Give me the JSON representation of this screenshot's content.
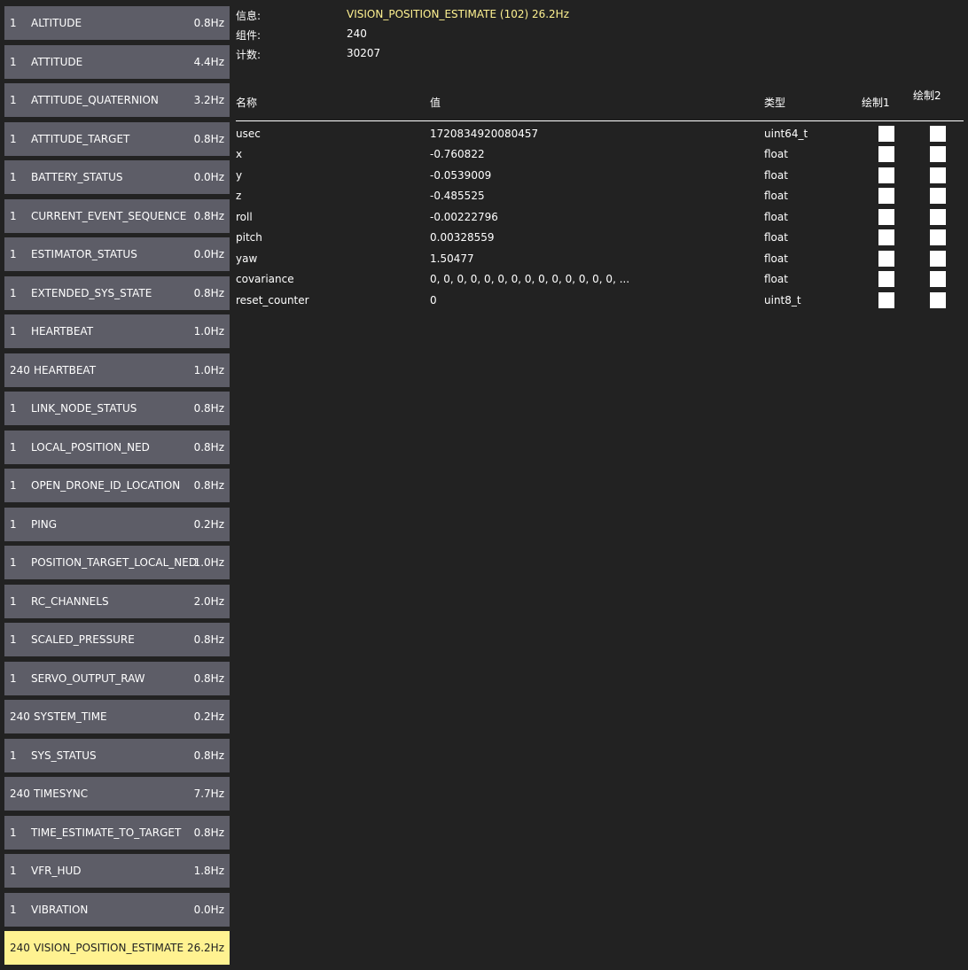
{
  "info": {
    "message_label": "信息:",
    "message_value": "VISION_POSITION_ESTIMATE (102) 26.2Hz",
    "component_label": "组件:",
    "component_value": "240",
    "count_label": "计数:",
    "count_value": "30207"
  },
  "table": {
    "headers": {
      "name": "名称",
      "value": "值",
      "type": "类型",
      "plot1": "绘制1",
      "plot2": "绘制2"
    },
    "rows": [
      {
        "name": "usec",
        "value": "1720834920080457",
        "type": "uint64_t"
      },
      {
        "name": "x",
        "value": "-0.760822",
        "type": "float"
      },
      {
        "name": "y",
        "value": "-0.0539009",
        "type": "float"
      },
      {
        "name": "z",
        "value": "-0.485525",
        "type": "float"
      },
      {
        "name": "roll",
        "value": "-0.00222796",
        "type": "float"
      },
      {
        "name": "pitch",
        "value": "0.00328559",
        "type": "float"
      },
      {
        "name": "yaw",
        "value": "1.50477",
        "type": "float"
      },
      {
        "name": "covariance",
        "value": "0, 0, 0, 0, 0, 0, 0, 0, 0, 0, 0, 0, 0, 0, ...",
        "type": "float"
      },
      {
        "name": "reset_counter",
        "value": "0",
        "type": "uint8_t"
      }
    ]
  },
  "messages": [
    {
      "comp": "1",
      "name": "ALTITUDE",
      "rate": "0.8Hz"
    },
    {
      "comp": "1",
      "name": "ATTITUDE",
      "rate": "4.4Hz"
    },
    {
      "comp": "1",
      "name": "ATTITUDE_QUATERNION",
      "rate": "3.2Hz"
    },
    {
      "comp": "1",
      "name": "ATTITUDE_TARGET",
      "rate": "0.8Hz"
    },
    {
      "comp": "1",
      "name": "BATTERY_STATUS",
      "rate": "0.0Hz"
    },
    {
      "comp": "1",
      "name": "CURRENT_EVENT_SEQUENCE",
      "rate": "0.8Hz"
    },
    {
      "comp": "1",
      "name": "ESTIMATOR_STATUS",
      "rate": "0.0Hz"
    },
    {
      "comp": "1",
      "name": "EXTENDED_SYS_STATE",
      "rate": "0.8Hz"
    },
    {
      "comp": "1",
      "name": "HEARTBEAT",
      "rate": "1.0Hz"
    },
    {
      "comp": "240",
      "name": "HEARTBEAT",
      "rate": "1.0Hz"
    },
    {
      "comp": "1",
      "name": "LINK_NODE_STATUS",
      "rate": "0.8Hz"
    },
    {
      "comp": "1",
      "name": "LOCAL_POSITION_NED",
      "rate": "0.8Hz"
    },
    {
      "comp": "1",
      "name": "OPEN_DRONE_ID_LOCATION",
      "rate": "0.8Hz"
    },
    {
      "comp": "1",
      "name": "PING",
      "rate": "0.2Hz"
    },
    {
      "comp": "1",
      "name": "POSITION_TARGET_LOCAL_NED",
      "rate": "1.0Hz"
    },
    {
      "comp": "1",
      "name": "RC_CHANNELS",
      "rate": "2.0Hz"
    },
    {
      "comp": "1",
      "name": "SCALED_PRESSURE",
      "rate": "0.8Hz"
    },
    {
      "comp": "1",
      "name": "SERVO_OUTPUT_RAW",
      "rate": "0.8Hz"
    },
    {
      "comp": "240",
      "name": "SYSTEM_TIME",
      "rate": "0.2Hz"
    },
    {
      "comp": "1",
      "name": "SYS_STATUS",
      "rate": "0.8Hz"
    },
    {
      "comp": "240",
      "name": "TIMESYNC",
      "rate": "7.7Hz"
    },
    {
      "comp": "1",
      "name": "TIME_ESTIMATE_TO_TARGET",
      "rate": "0.8Hz"
    },
    {
      "comp": "1",
      "name": "VFR_HUD",
      "rate": "1.8Hz"
    },
    {
      "comp": "1",
      "name": "VIBRATION",
      "rate": "0.0Hz"
    },
    {
      "comp": "240",
      "name": "VISION_POSITION_ESTIMATE",
      "rate": "26.2Hz",
      "selected": true
    }
  ],
  "colors": {
    "background": "#222222",
    "button": "#5d5d67",
    "selected": "#fff291",
    "highlight_text": "#fff291"
  }
}
